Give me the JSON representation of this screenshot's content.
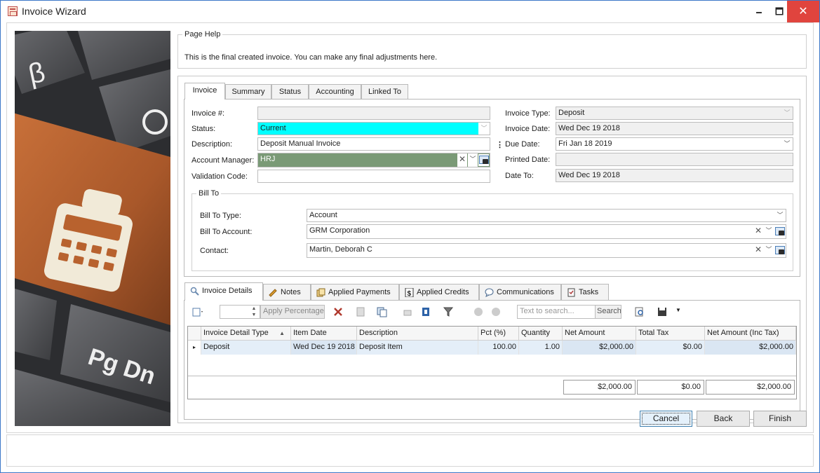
{
  "window": {
    "title": "Invoice Wizard",
    "minimize": "🗕",
    "maximize": "🗖",
    "close": "✕"
  },
  "page_help": {
    "legend": "Page Help",
    "text": "This is the final created invoice.  You can make any final adjustments here."
  },
  "tabs": [
    "Invoice",
    "Summary",
    "Status",
    "Accounting",
    "Linked To"
  ],
  "invoice": {
    "invoice_no_label": "Invoice #:",
    "invoice_no_value": "",
    "status_label": "Status:",
    "status_value": "Current",
    "description_label": "Description:",
    "description_value": "Deposit Manual Invoice",
    "account_manager_label": "Account Manager:",
    "account_manager_value": "HRJ",
    "validation_code_label": "Validation Code:",
    "validation_code_value": "",
    "invoice_type_label": "Invoice Type:",
    "invoice_type_value": "Deposit",
    "invoice_date_label": "Invoice Date:",
    "invoice_date_value": "Wed Dec 19 2018",
    "due_date_label": "Due Date:",
    "due_date_value": "Fri Jan 18 2019",
    "printed_date_label": "Printed Date:",
    "printed_date_value": "",
    "date_to_label": "Date To:",
    "date_to_value": "Wed Dec 19 2018"
  },
  "bill_to": {
    "legend": "Bill To",
    "type_label": "Bill To Type:",
    "type_value": "Account",
    "account_label": "Bill To Account:",
    "account_value": "GRM Corporation",
    "contact_label": "Contact:",
    "contact_value": "Martin, Deborah C"
  },
  "bottom_tabs": [
    "Invoice Details",
    "Notes",
    "Applied Payments",
    "Applied Credits",
    "Communications",
    "Tasks"
  ],
  "toolbar": {
    "apply_percentage": "Apply Percentage",
    "search_placeholder": "Text to search...",
    "search_button": "Search"
  },
  "grid": {
    "columns": [
      "Invoice Detail Type",
      "Item Date",
      "Description",
      "Pct (%)",
      "Quantity",
      "Net Amount",
      "Total Tax",
      "Net Amount (Inc Tax)"
    ],
    "rows": [
      [
        "Deposit",
        "Wed Dec 19 2018",
        "Deposit Item",
        "100.00",
        "1.00",
        "$2,000.00",
        "$0.00",
        "$2,000.00"
      ]
    ],
    "totals": {
      "net_amount": "$2,000.00",
      "total_tax": "$0.00",
      "net_inc_tax": "$2,000.00"
    }
  },
  "buttons": {
    "cancel": "Cancel",
    "back": "Back",
    "finish": "Finish"
  },
  "colors": {
    "status_bg": "#00ffff",
    "account_manager_bg": "#7a9a76",
    "accent": "#3c78c8"
  }
}
